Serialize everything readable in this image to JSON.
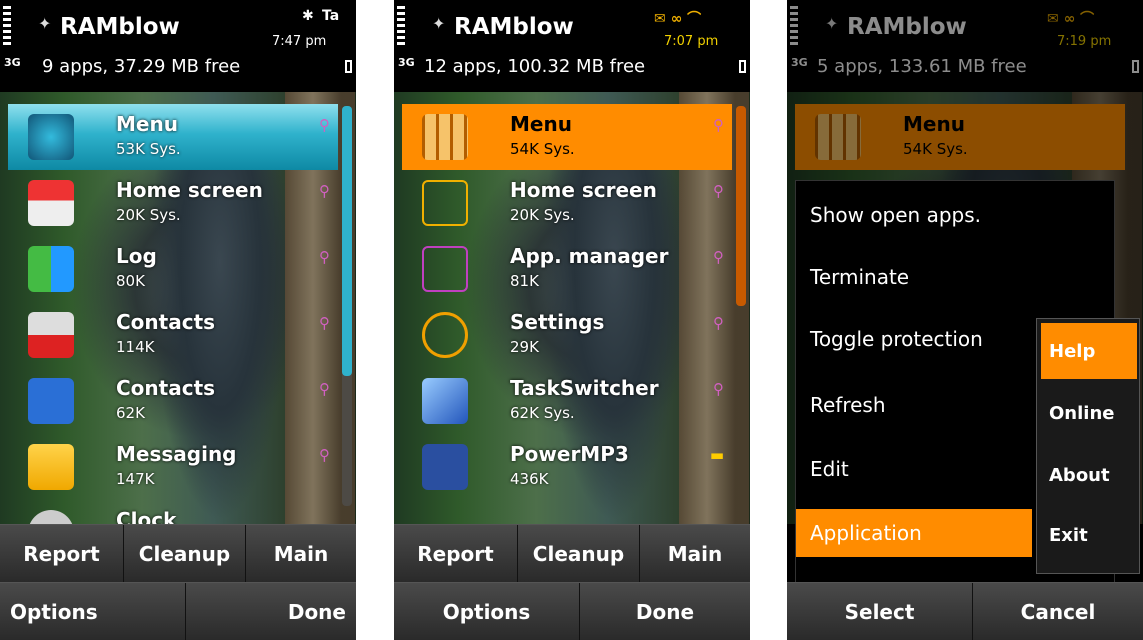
{
  "screens": [
    {
      "title": "RAMblow",
      "time": "7:47 pm",
      "network": "3G",
      "summary": "9 apps, 37.29 MB free",
      "selection_color": "#2fb2cc",
      "apps": [
        {
          "name": "Menu",
          "memory": "53K Sys.",
          "icon": "menu-icon"
        },
        {
          "name": "Home screen",
          "memory": "20K Sys.",
          "icon": "home-icon"
        },
        {
          "name": "Log",
          "memory": "80K",
          "icon": "log-icon"
        },
        {
          "name": "Contacts",
          "memory": "114K",
          "icon": "puzzle-icon"
        },
        {
          "name": "Contacts",
          "memory": "62K",
          "icon": "contacts-icon"
        },
        {
          "name": "Messaging",
          "memory": "147K",
          "icon": "envelope-icon"
        },
        {
          "name": "Clock",
          "memory": "",
          "icon": "clock-icon"
        }
      ],
      "buttons": [
        "Report",
        "Cleanup",
        "Main"
      ],
      "softkeys": {
        "left": "Options",
        "right": "Done"
      }
    },
    {
      "title": "RAMblow",
      "time": "7:07 pm",
      "network": "3G",
      "summary": "12 apps, 100.32 MB free",
      "selection_color": "#ff8c00",
      "apps": [
        {
          "name": "Menu",
          "memory": "54K Sys.",
          "icon": "grid-menu-icon"
        },
        {
          "name": "Home screen",
          "memory": "20K Sys.",
          "icon": "home-screen-icon"
        },
        {
          "name": "App. manager",
          "memory": "81K",
          "icon": "app-manager-icon"
        },
        {
          "name": "Settings",
          "memory": "29K",
          "icon": "gear-icon"
        },
        {
          "name": "TaskSwitcher",
          "memory": "62K Sys.",
          "icon": "taskswitcher-icon"
        },
        {
          "name": "PowerMP3",
          "memory": "436K",
          "icon": "music-icon"
        }
      ],
      "buttons": [
        "Report",
        "Cleanup",
        "Main"
      ],
      "softkeys": {
        "left": "Options",
        "right": "Done"
      }
    },
    {
      "title": "RAMblow",
      "time": "7:19 pm",
      "network": "3G",
      "summary": "5 apps, 133.61 MB free",
      "background_app": {
        "name": "Menu",
        "memory": "54K Sys."
      },
      "menu": [
        "Show open apps.",
        "Terminate",
        "Toggle protection",
        "Refresh",
        "Edit",
        "Application"
      ],
      "submenu": [
        "Help",
        "Online",
        "About",
        "Exit"
      ],
      "softkeys": {
        "left": "Select",
        "right": "Cancel"
      }
    }
  ]
}
